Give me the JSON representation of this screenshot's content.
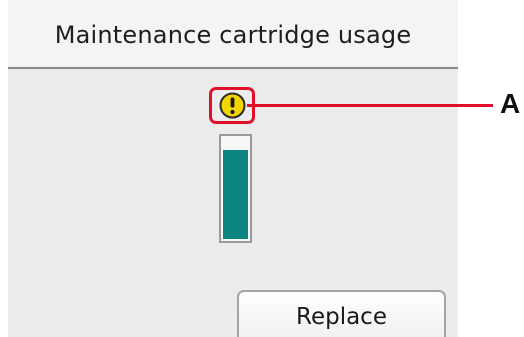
{
  "screen": {
    "title": "Maintenance cartridge usage",
    "replace_label": "Replace"
  },
  "gauge": {
    "fill_fraction": 0.88,
    "fill_color": "#0d8583"
  },
  "warning": {
    "icon": "exclamation-warning-icon",
    "color": "#f2d600"
  },
  "callout": {
    "letter": "A",
    "color": "#e0102a"
  }
}
